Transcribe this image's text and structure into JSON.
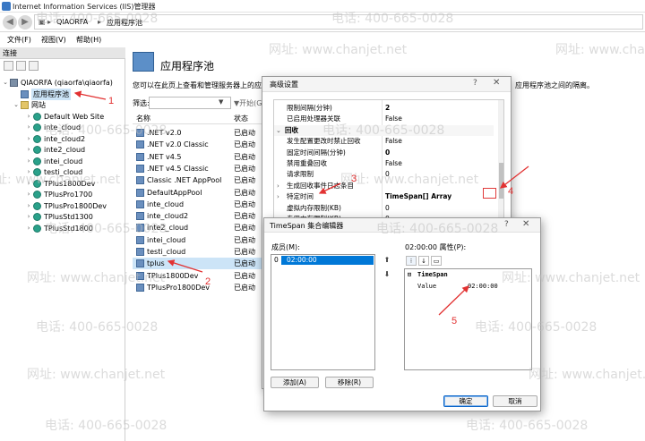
{
  "window": {
    "title": "Internet Information Services (IIS)管理器"
  },
  "address": {
    "crumbs": [
      "QIAORFA",
      "应用程序池"
    ]
  },
  "menu": {
    "items": [
      "文件(F)",
      "视图(V)",
      "帮助(H)"
    ]
  },
  "connections": {
    "header": "连接",
    "tree": [
      {
        "label": "QIAORFA (qiaorfa\\qiaorfa)",
        "level": 0,
        "icon": "server-icon"
      },
      {
        "label": "应用程序池",
        "level": 1,
        "icon": "app-pool-icon",
        "selected": true
      },
      {
        "label": "网站",
        "level": 1,
        "icon": "sites-folder-icon"
      },
      {
        "label": "Default Web Site",
        "level": 2,
        "icon": "globe-icon"
      },
      {
        "label": "inte_cloud",
        "level": 2,
        "icon": "globe-icon"
      },
      {
        "label": "inte_cloud2",
        "level": 2,
        "icon": "globe-icon"
      },
      {
        "label": "inte2_cloud",
        "level": 2,
        "icon": "globe-icon"
      },
      {
        "label": "intei_cloud",
        "level": 2,
        "icon": "globe-icon"
      },
      {
        "label": "testi_cloud",
        "level": 2,
        "icon": "globe-icon"
      },
      {
        "label": "TPlus1800Dev",
        "level": 2,
        "icon": "globe-icon"
      },
      {
        "label": "TPlusPro1700",
        "level": 2,
        "icon": "globe-icon"
      },
      {
        "label": "TPlusPro1800Dev",
        "level": 2,
        "icon": "globe-icon"
      },
      {
        "label": "TPlusStd1300",
        "level": 2,
        "icon": "globe-icon"
      },
      {
        "label": "TPlusStd1800",
        "level": 2,
        "icon": "globe-icon"
      }
    ]
  },
  "main": {
    "title": "应用程序池",
    "description": "您可以在此页上查看和管理服务器上的应用",
    "description_tail": "应用程序池之间的隔离。",
    "filter_label": "筛选:",
    "filter_go": "▼开始(G)",
    "columns": [
      "名称",
      "状态"
    ],
    "pools": [
      {
        "name": ".NET v2.0",
        "status": "已启动"
      },
      {
        "name": ".NET v2.0 Classic",
        "status": "已启动"
      },
      {
        "name": ".NET v4.5",
        "status": "已启动"
      },
      {
        "name": ".NET v4.5 Classic",
        "status": "已启动"
      },
      {
        "name": "Classic .NET AppPool",
        "status": "已启动"
      },
      {
        "name": "DefaultAppPool",
        "status": "已启动"
      },
      {
        "name": "inte_cloud",
        "status": "已启动"
      },
      {
        "name": "inte_cloud2",
        "status": "已启动"
      },
      {
        "name": "inte2_cloud",
        "status": "已启动"
      },
      {
        "name": "intei_cloud",
        "status": "已启动"
      },
      {
        "name": "testi_cloud",
        "status": "已启动"
      },
      {
        "name": "tplus",
        "status": "已启动",
        "selected": true
      },
      {
        "name": "TPlus1800Dev",
        "status": "已启动"
      },
      {
        "name": "TPlusPro1800Dev",
        "status": "已启动"
      }
    ]
  },
  "advanced_dialog": {
    "title": "高级设置",
    "help": "?",
    "close": "✕",
    "rows": [
      {
        "key": "限制间隔(分钟)",
        "value": "2",
        "bold": true
      },
      {
        "key": "已启用处理器关联",
        "value": "False"
      },
      {
        "key": "回收",
        "value": "",
        "section": true
      },
      {
        "key": "发生配置更改时禁止回收",
        "value": "False"
      },
      {
        "key": "固定时间间隔(分钟)",
        "value": "0",
        "bold": true
      },
      {
        "key": "禁用重叠回收",
        "value": "False"
      },
      {
        "key": "请求限制",
        "value": "0"
      },
      {
        "key": "生成回收事件日志条目",
        "value": "",
        "expander": true
      },
      {
        "key": "特定时间",
        "value": "TimeSpan[] Array",
        "expander": true,
        "bold": true
      },
      {
        "key": "虚拟内存限制(KB)",
        "value": "0"
      },
      {
        "key": "专用内存限制(KB)",
        "value": "0"
      }
    ]
  },
  "timespan_dialog": {
    "title": "TimeSpan 集合编辑器",
    "help": "?",
    "close": "✕",
    "members_label": "成员(M):",
    "member_index": "0",
    "member_value": "02:00:00",
    "props_label": "02:00:00 属性(P):",
    "category": "TimeSpan",
    "prop_name": "Value",
    "prop_value": "02:00:00",
    "add_button": "添加(A)",
    "remove_button": "移除(R)",
    "ok_button": "确定",
    "cancel_button": "取消"
  },
  "annotations": [
    "1",
    "2",
    "3",
    "4",
    "5"
  ],
  "watermark": {
    "phone": "电话: 400-665-0028",
    "site": "网址: www.chanjet.net"
  }
}
